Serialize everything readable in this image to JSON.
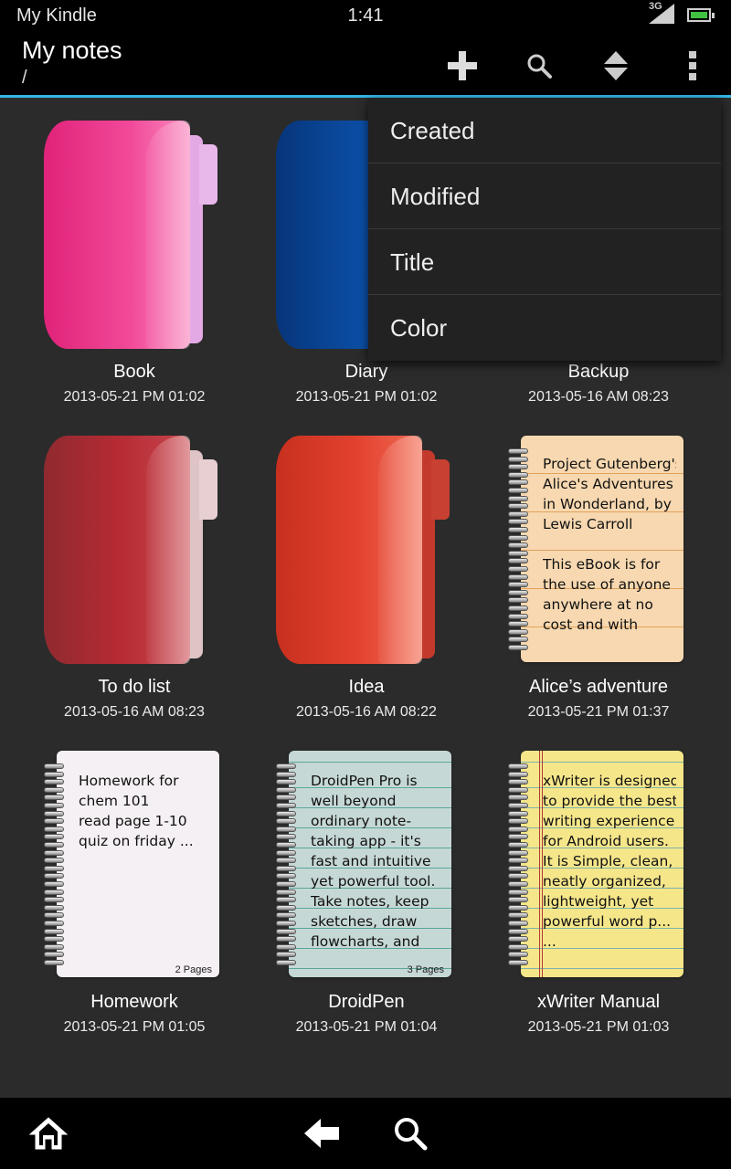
{
  "status_bar": {
    "carrier": "My Kindle",
    "time": "1:41",
    "network": "3G"
  },
  "action_bar": {
    "title": "My notes",
    "path": "/",
    "icons": [
      "add-icon",
      "search-icon",
      "sort-icon",
      "overflow-menu-icon"
    ]
  },
  "sort_menu": {
    "items": [
      "Created",
      "Modified",
      "Title",
      "Color"
    ]
  },
  "notes": [
    {
      "name": "Book",
      "date": "2013-05-21 PM 01:02",
      "kind": "folder",
      "color": "#f0358c"
    },
    {
      "name": "Diary",
      "date": "2013-05-21 PM 01:02",
      "kind": "folder",
      "color": "#0c4fa6"
    },
    {
      "name": "Backup",
      "date": "2013-05-16 AM 08:23",
      "kind": "folder",
      "color": "#666666"
    },
    {
      "name": "To do list",
      "date": "2013-05-16 AM 08:23",
      "kind": "folder",
      "color": "#b52a33"
    },
    {
      "name": "Idea",
      "date": "2013-05-16 AM 08:22",
      "kind": "folder",
      "color": "#e2412e"
    },
    {
      "name": "Alice’s adventure",
      "date": "2013-05-21 PM 01:37",
      "kind": "notebook",
      "color": "#f7d8b0",
      "lines": [
        "Project Gutenberg's",
        "Alice's Adventures",
        "in Wonderland, by",
        "Lewis Carroll",
        "",
        "This eBook is for",
        "the use of anyone",
        "anywhere at no",
        "cost and with"
      ]
    },
    {
      "name": "Homework",
      "date": "2013-05-21 PM 01:05",
      "kind": "notebook",
      "color": "#f5f0f3",
      "lines": [
        "Homework for",
        "chem 101",
        "read page 1-10",
        "quiz on friday ..."
      ],
      "pages": "2 Pages"
    },
    {
      "name": "DroidPen",
      "date": "2013-05-21 PM 01:04",
      "kind": "notebook",
      "color": "#c6d8d6",
      "lines": [
        "DroidPen Pro is",
        "well beyond",
        "ordinary note-",
        "taking app - it's",
        "fast and intuitive",
        "yet powerful tool.",
        "Take notes, keep",
        "sketches, draw",
        "flowcharts, and"
      ],
      "pages": "3 Pages"
    },
    {
      "name": "xWriter Manual",
      "date": "2013-05-21 PM 01:03",
      "kind": "notebook",
      "color": "#f5e68a",
      "lines": [
        "xWriter is designed",
        "to provide the best",
        "writing experience",
        "for Android users.",
        "It is Simple, clean,",
        "neatly organized,",
        "lightweight, yet",
        "powerful word p...",
        "..."
      ]
    }
  ],
  "bottom_nav": {
    "icons": [
      "home-icon",
      "back-icon",
      "search-icon"
    ]
  }
}
